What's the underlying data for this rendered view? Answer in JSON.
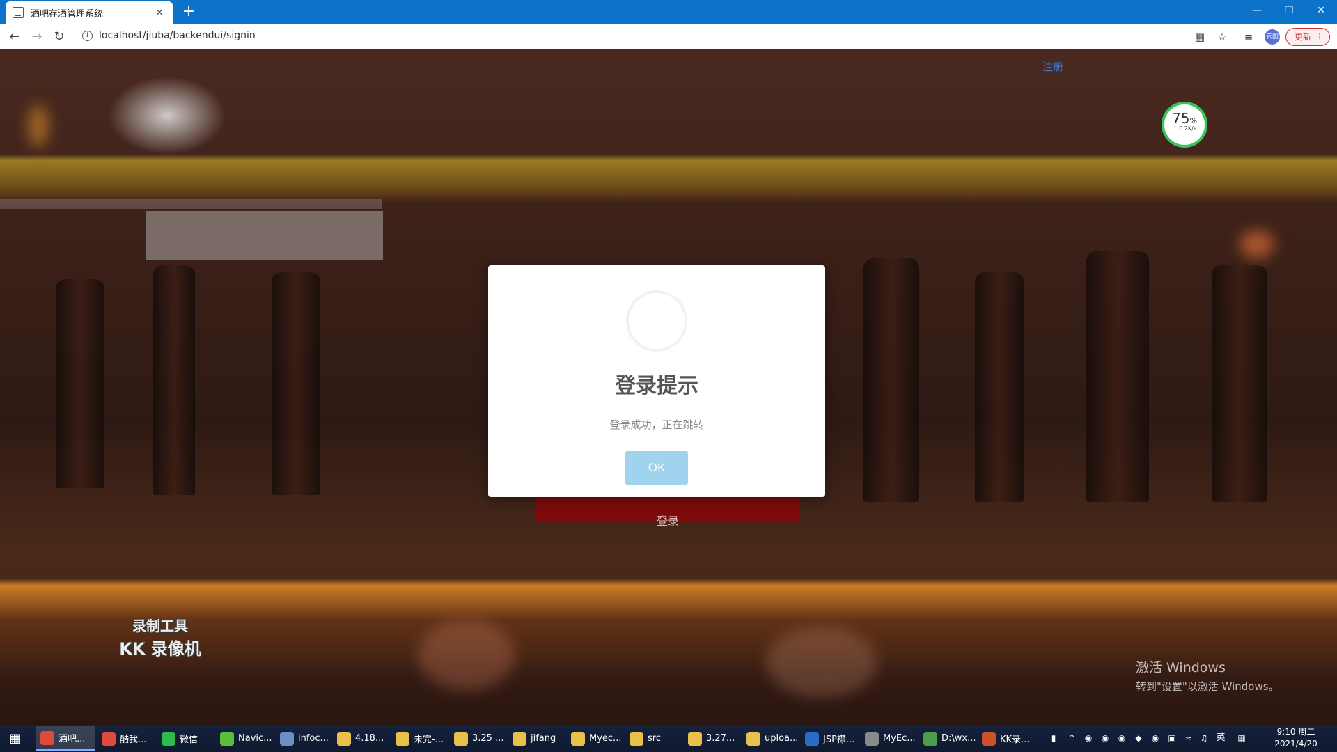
{
  "browser": {
    "tab_title": "酒吧存酒管理系统",
    "tab_close": "×",
    "new_tab": "+",
    "url": "localhost/jiuba/backendui/signin",
    "update_label": "更新",
    "profile_label": "云图"
  },
  "page": {
    "signup_link": "注册",
    "speed_percent": "75",
    "speed_percent_unit": "%",
    "speed_rate": "↑ 0.2K/s",
    "login_button": "登录",
    "recorder_watermark_line1": "录制工具",
    "recorder_watermark_line2": "KK 录像机",
    "activate_line1": "激活 Windows",
    "activate_line2": "转到\"设置\"以激活 Windows。"
  },
  "modal": {
    "title": "登录提示",
    "message": "登录成功，正在跳转",
    "ok_label": "OK"
  },
  "taskbar": {
    "items": [
      {
        "label": "酒吧...",
        "color": "#e04a3a"
      },
      {
        "label": "酷我...",
        "color": "#e04a3a"
      },
      {
        "label": "微信",
        "color": "#2dbb4e"
      },
      {
        "label": "Navic...",
        "color": "#5bbf3b"
      },
      {
        "label": "infoc...",
        "color": "#6c8fc8"
      },
      {
        "label": "4.18...",
        "color": "#e8c04a"
      },
      {
        "label": "未完-...",
        "color": "#e8c04a"
      },
      {
        "label": "3.25 ...",
        "color": "#e8c04a"
      },
      {
        "label": "jifang",
        "color": "#e8c04a"
      },
      {
        "label": "Myec...",
        "color": "#e8c04a"
      },
      {
        "label": "src",
        "color": "#e8c04a"
      },
      {
        "label": "3.27...",
        "color": "#e8c04a"
      },
      {
        "label": "uploa...",
        "color": "#e8c04a"
      },
      {
        "label": "JSP襟...",
        "color": "#2b6cc4"
      },
      {
        "label": "MyEc...",
        "color": "#8a8a8a"
      },
      {
        "label": "D:\\wx...",
        "color": "#4aa04a"
      },
      {
        "label": "KK录...",
        "color": "#d0502a"
      }
    ],
    "ime": "英",
    "time": "9:10 周二",
    "date": "2021/4/20"
  }
}
